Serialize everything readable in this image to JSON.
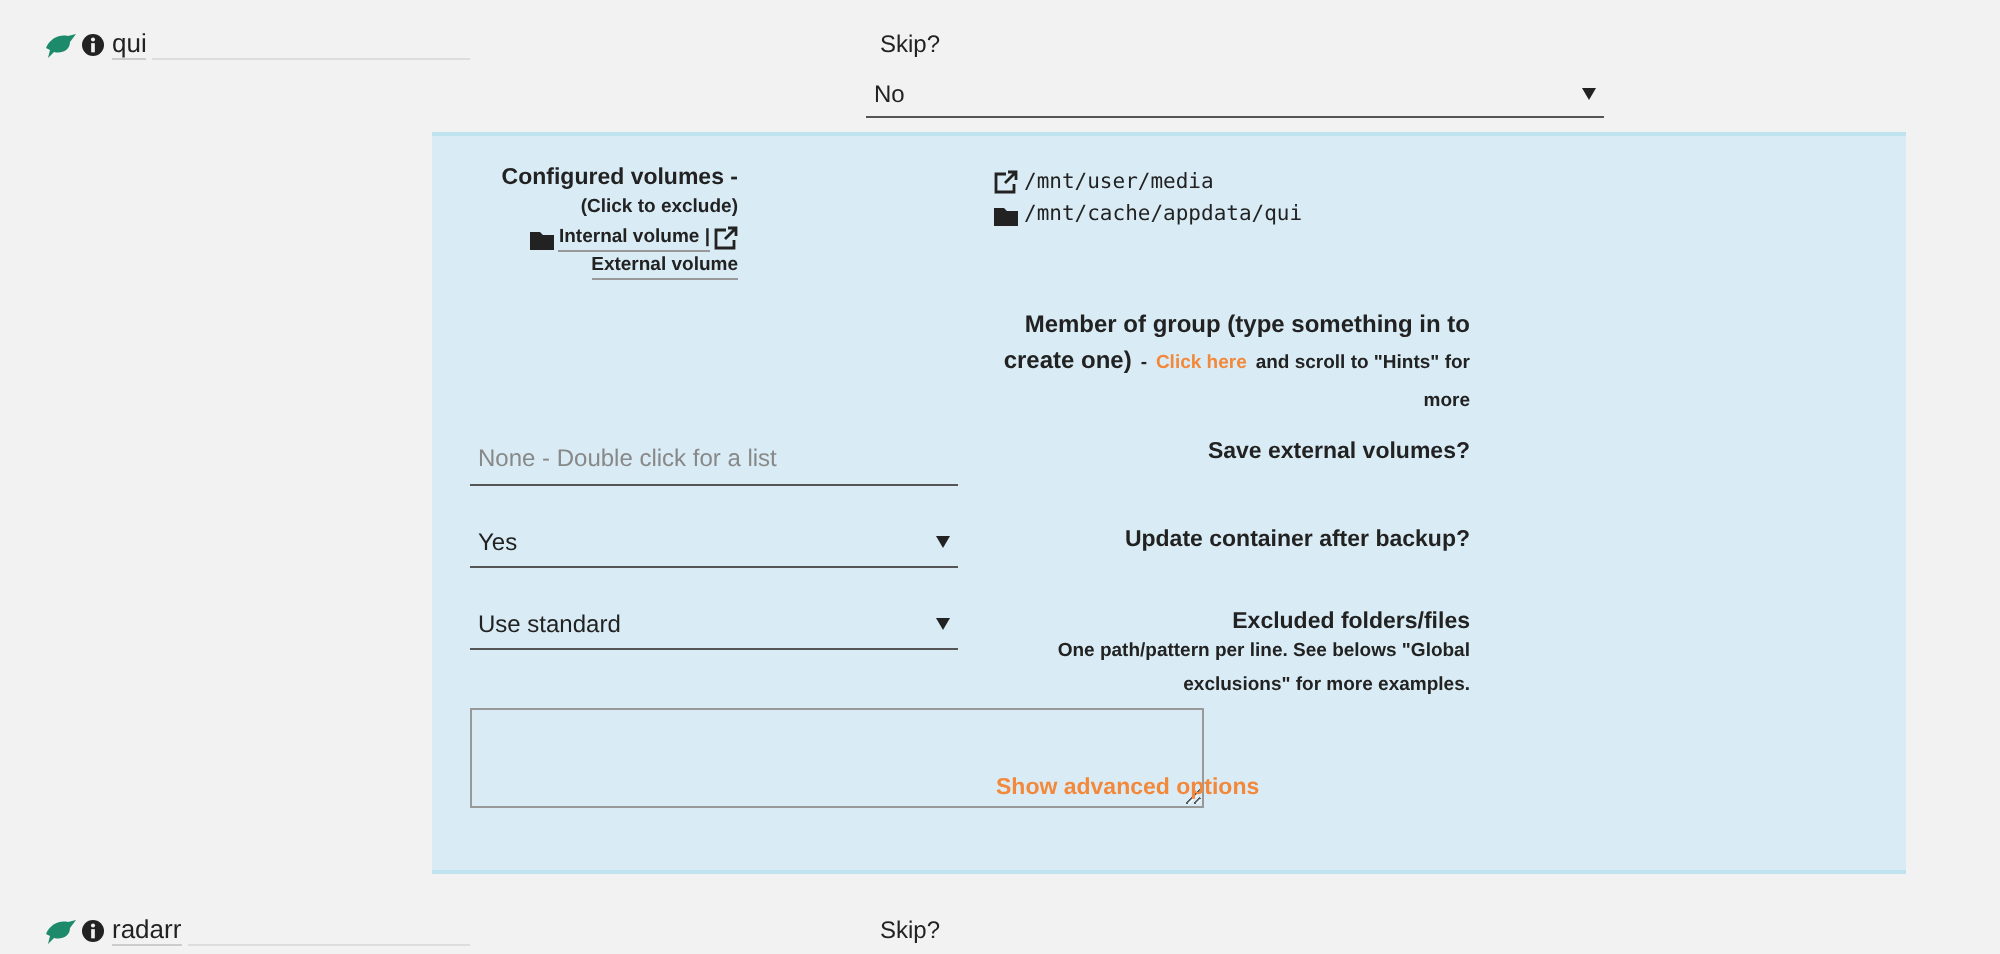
{
  "container": {
    "name": "qui",
    "skip_label": "Skip?",
    "skip_value": "No"
  },
  "volumes": {
    "label": "Configured volumes -",
    "hint": "(Click to exclude)",
    "internal_legend": "Internal volume |",
    "external_legend": "External volume",
    "paths": [
      {
        "kind": "external",
        "path": "/mnt/user/media"
      },
      {
        "kind": "internal",
        "path": "/mnt/cache/appdata/qui"
      }
    ]
  },
  "group": {
    "label": "Member of group (type something in to create one)",
    "dash": "-",
    "link": "Click here",
    "note": "and scroll to \"Hints\" for more"
  },
  "fields": [
    {
      "kind": "text",
      "placeholder": "None - Double click for a list",
      "label": "Save external volumes?"
    },
    {
      "kind": "select",
      "value": "Yes",
      "label": "Update container after backup?"
    },
    {
      "kind": "select",
      "value": "Use standard",
      "label": "Excluded folders/files",
      "note": "One path/pattern per line. See belows \"Global exclusions\" for more examples."
    }
  ],
  "advanced_link": "Show advanced options",
  "next_container": {
    "name": "radarr",
    "skip_label": "Skip?"
  }
}
